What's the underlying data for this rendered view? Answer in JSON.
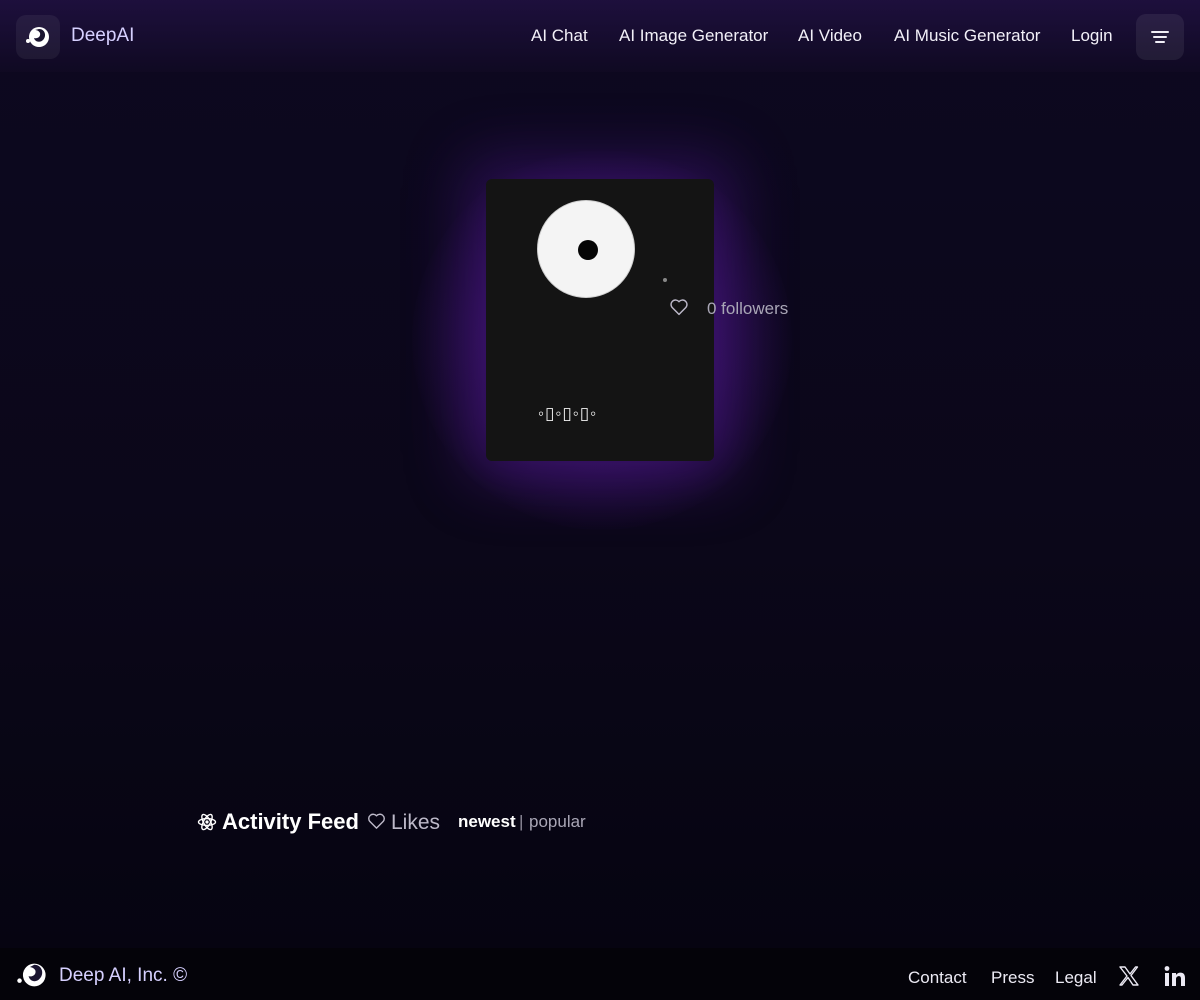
{
  "header": {
    "brand": "DeepAI",
    "nav": [
      {
        "label": "AI Chat"
      },
      {
        "label": "AI Image Generator"
      },
      {
        "label": "AI Video"
      },
      {
        "label": "AI Music Generator"
      },
      {
        "label": "Login"
      }
    ],
    "menu_icon": "hamburger-menu-icon"
  },
  "profile": {
    "followers_text": "0 followers",
    "username": "◦▯◦▯◦▯◦",
    "avatar_icon": "default-avatar",
    "follow_icon": "heart-outline-icon"
  },
  "feed": {
    "title": "Activity Feed",
    "title_icon": "atom-icon",
    "likes_label": "Likes",
    "likes_icon": "heart-outline-icon",
    "sort": {
      "active": "newest",
      "separator": "|",
      "other": "popular"
    }
  },
  "footer": {
    "copyright": "Deep AI, Inc. ©",
    "links": [
      {
        "label": "Contact"
      },
      {
        "label": "Press"
      },
      {
        "label": "Legal"
      }
    ],
    "social_icons": [
      "x-twitter-icon",
      "linkedin-icon"
    ]
  },
  "colors": {
    "background": "#0b0719",
    "accent_glow": "#7828c8",
    "card": "#141414",
    "brand_text": "#d6d0ff"
  }
}
